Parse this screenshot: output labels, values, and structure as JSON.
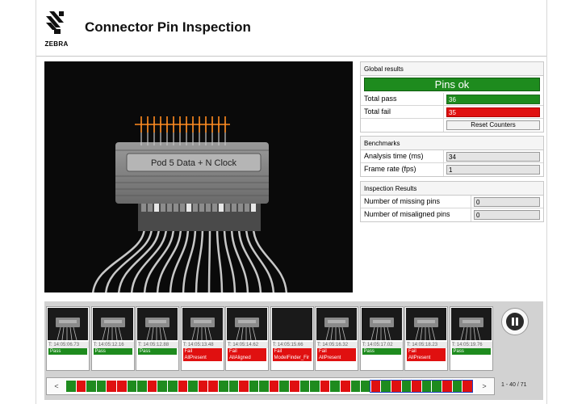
{
  "header": {
    "logo_text": "ZEBRA",
    "title": "Connector Pin Inspection"
  },
  "camera": {
    "label_text": "Pod 5 Data  +  N Clock"
  },
  "global_results": {
    "title": "Global results",
    "status": "Pins ok",
    "total_pass_label": "Total pass",
    "total_pass_value": "36",
    "total_fail_label": "Total fail",
    "total_fail_value": "35",
    "reset_label": "Reset Counters"
  },
  "benchmarks": {
    "title": "Benchmarks",
    "analysis_label": "Analysis time (ms)",
    "analysis_value": "34",
    "frame_label": "Frame rate (fps)",
    "frame_value": "1"
  },
  "inspection_results": {
    "title": "Inspection Results",
    "missing_label": "Number of missing pins",
    "missing_value": "0",
    "misaligned_label": "Number of misaligned pins",
    "misaligned_value": "0"
  },
  "history": {
    "thumbnails": [
      {
        "time": "T: 14:05:06.73",
        "status": "Pass",
        "detail": ""
      },
      {
        "time": "T: 14:05:12.16",
        "status": "Pass",
        "detail": ""
      },
      {
        "time": "T: 14:05:12.88",
        "status": "Pass",
        "detail": ""
      },
      {
        "time": "T: 14:05:13.48",
        "status": "Fail",
        "detail": "AllPresent"
      },
      {
        "time": "T: 14:05:14.62",
        "status": "Fail",
        "detail": "AllAligned"
      },
      {
        "time": "T: 14:05:15.66",
        "status": "Fail",
        "detail": "ModelFinder_Fir"
      },
      {
        "time": "T: 14:05:16.32",
        "status": "Fail",
        "detail": "AllPresent"
      },
      {
        "time": "T: 14:05:17.02",
        "status": "Pass",
        "detail": ""
      },
      {
        "time": "T: 14:05:18.23",
        "status": "Fail",
        "detail": "AllPresent"
      },
      {
        "time": "T: 14:05:19.76",
        "status": "Pass",
        "detail": ""
      }
    ],
    "prev_label": "<",
    "next_label": ">",
    "page_indicator": "1 - 40 / 71",
    "result_strip": [
      "pass",
      "fail",
      "pass",
      "pass",
      "fail",
      "fail",
      "pass",
      "pass",
      "fail",
      "pass",
      "pass",
      "fail",
      "pass",
      "fail",
      "fail",
      "pass",
      "pass",
      "fail",
      "pass",
      "pass",
      "fail",
      "pass",
      "fail",
      "pass",
      "pass",
      "fail",
      "pass",
      "fail",
      "pass",
      "pass",
      "fail",
      "pass",
      "fail",
      "pass",
      "fail",
      "pass",
      "pass",
      "fail",
      "pass",
      "fail"
    ]
  },
  "colors": {
    "pass": "#1e8b1e",
    "fail": "#e01010",
    "pin_highlight": "#ff8a1e"
  },
  "icons": {
    "logo": "zebra-logo-icon",
    "pause": "pause-icon"
  }
}
